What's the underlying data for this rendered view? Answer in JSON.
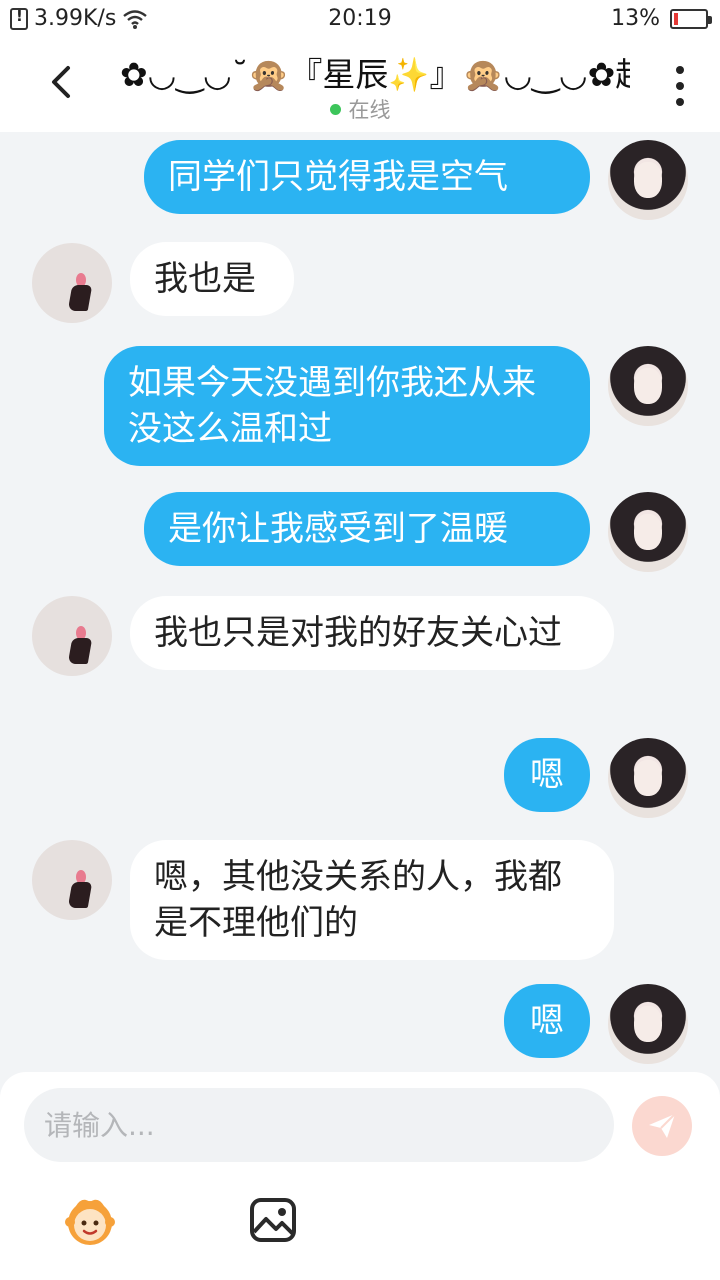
{
  "status_bar": {
    "speed": "3.99K/s",
    "time": "20:19",
    "battery": "13%",
    "battery_level": 0.13
  },
  "header": {
    "title": "✿◡‿◡˘🙊『星辰✨』🙊◡‿◡✿越…",
    "presence": "在线"
  },
  "messages": [
    {
      "side": "me",
      "text": "同学们只觉得我是空气"
    },
    {
      "side": "them",
      "text": "我也是"
    },
    {
      "side": "me",
      "text": "如果今天没遇到你我还从来没这么温和过"
    },
    {
      "side": "me",
      "text": "是你让我感受到了温暖"
    },
    {
      "side": "them",
      "text": "我也只是对我的好友关心过"
    },
    {
      "side": "me",
      "text": "嗯"
    },
    {
      "side": "them",
      "text": "嗯，其他没关系的人，我都是不理他们的"
    },
    {
      "side": "me",
      "text": "嗯"
    }
  ],
  "composer": {
    "placeholder": "请输入..."
  },
  "icons": {
    "back": "chevron-left-icon",
    "more": "more-vertical-icon",
    "send": "send-icon",
    "emoji": "emoji-icon",
    "image": "image-icon"
  },
  "colors": {
    "my_bubble": "#2bb3f2",
    "their_bubble": "#ffffff",
    "online": "#3cc55a",
    "send_button": "#fbd8d0"
  }
}
